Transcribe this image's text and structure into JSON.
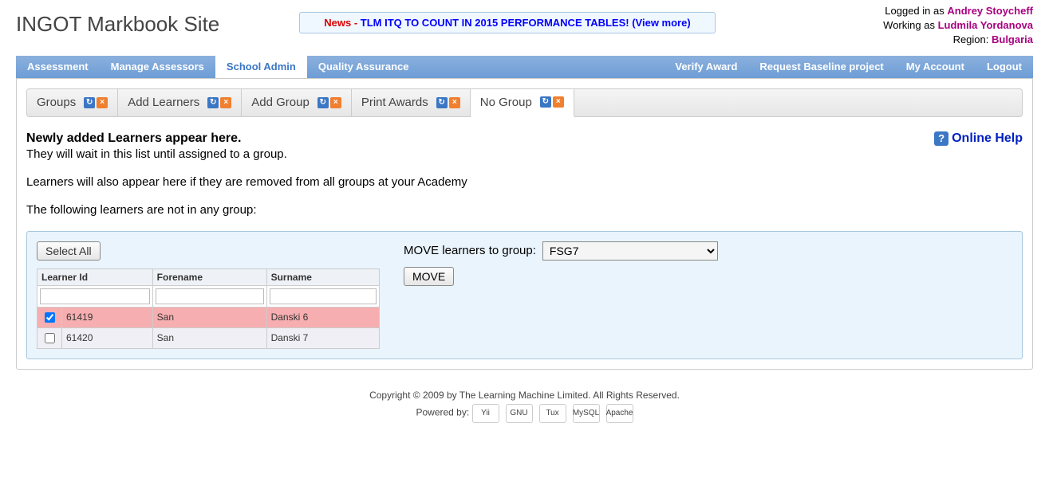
{
  "header": {
    "site_title": "INGOT Markbook Site",
    "news_label": "News - ",
    "news_text": "TLM ITQ TO COUNT IN 2015 PERFORMANCE TABLES! (View more)",
    "logged_in_prefix": "Logged in as ",
    "logged_in_user": "Andrey Stoycheff",
    "working_as_prefix": "Working as ",
    "working_as_user": "Ludmila Yordanova",
    "region_prefix": "Region: ",
    "region": "Bulgaria"
  },
  "nav": {
    "items": [
      "Assessment",
      "Manage Assessors",
      "School Admin",
      "Quality Assurance"
    ],
    "active": "School Admin",
    "right_items": [
      "Verify Award",
      "Request Baseline project",
      "My Account",
      "Logout"
    ]
  },
  "subtabs": {
    "items": [
      "Groups",
      "Add Learners",
      "Add Group",
      "Print Awards",
      "No Group"
    ],
    "active": "No Group"
  },
  "help": {
    "label": "Online Help"
  },
  "intro": {
    "heading": "Newly added Learners appear here.",
    "line1": "They will wait in this list until assigned to a group.",
    "line2": "Learners will also appear here if they are removed from all groups at your Academy",
    "line3": "The following learners are not in any group:"
  },
  "controls": {
    "select_all": "Select All",
    "move_label": "MOVE learners to group:",
    "selected_group": "FSG7",
    "move_button": "MOVE"
  },
  "table": {
    "headers": [
      "Learner Id",
      "Forename",
      "Surname"
    ],
    "rows": [
      {
        "checked": true,
        "id": "61419",
        "forename": "San",
        "surname": "Danski 6",
        "selected": true
      },
      {
        "checked": false,
        "id": "61420",
        "forename": "San",
        "surname": "Danski 7",
        "selected": false
      }
    ]
  },
  "footer": {
    "copyright": "Copyright © 2009 by The Learning Machine Limited. All Rights Reserved.",
    "powered_by": "Powered by:",
    "logos": [
      "Yii",
      "GNU",
      "Tux",
      "MySQL",
      "Apache"
    ]
  }
}
